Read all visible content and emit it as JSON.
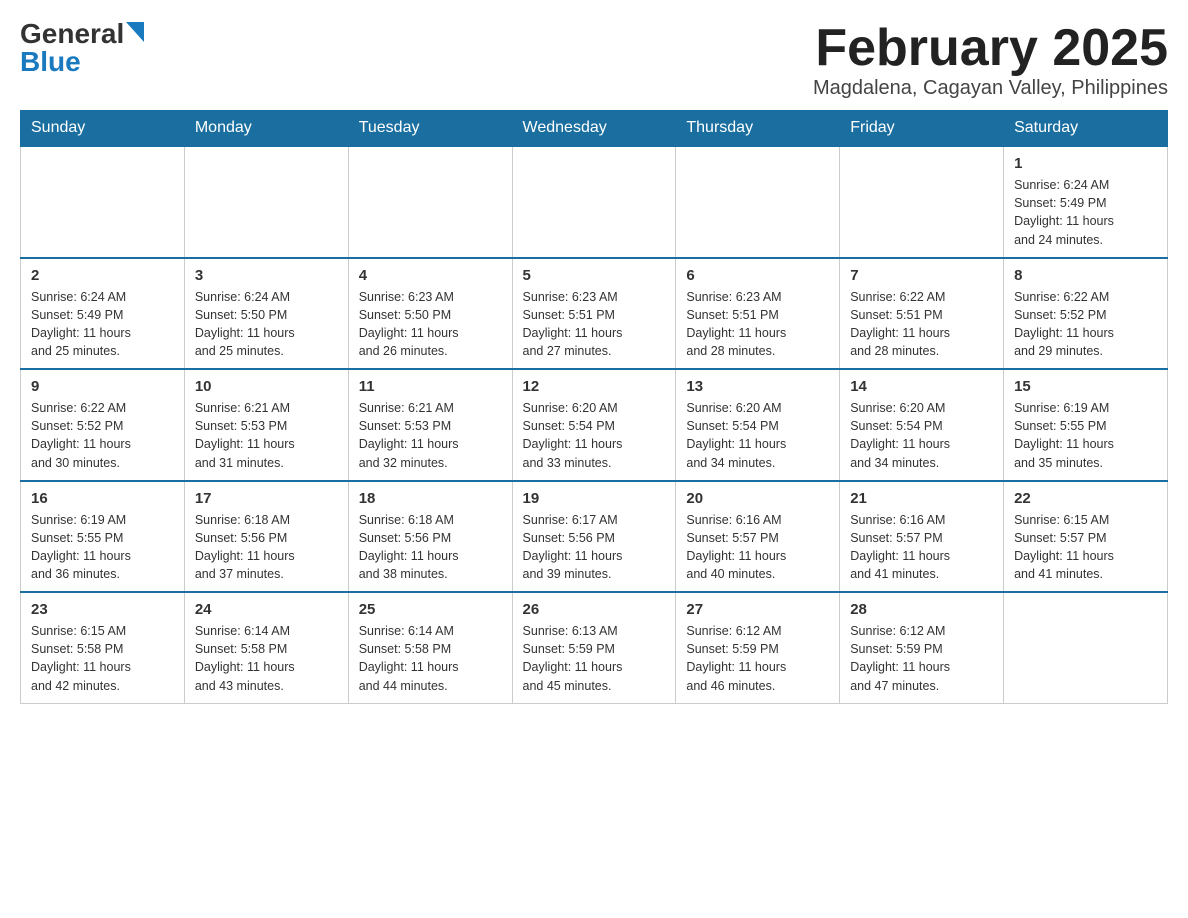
{
  "logo": {
    "general": "General",
    "blue": "Blue"
  },
  "title": "February 2025",
  "subtitle": "Magdalena, Cagayan Valley, Philippines",
  "days_of_week": [
    "Sunday",
    "Monday",
    "Tuesday",
    "Wednesday",
    "Thursday",
    "Friday",
    "Saturday"
  ],
  "weeks": [
    [
      {
        "day": "",
        "info": ""
      },
      {
        "day": "",
        "info": ""
      },
      {
        "day": "",
        "info": ""
      },
      {
        "day": "",
        "info": ""
      },
      {
        "day": "",
        "info": ""
      },
      {
        "day": "",
        "info": ""
      },
      {
        "day": "1",
        "info": "Sunrise: 6:24 AM\nSunset: 5:49 PM\nDaylight: 11 hours\nand 24 minutes."
      }
    ],
    [
      {
        "day": "2",
        "info": "Sunrise: 6:24 AM\nSunset: 5:49 PM\nDaylight: 11 hours\nand 25 minutes."
      },
      {
        "day": "3",
        "info": "Sunrise: 6:24 AM\nSunset: 5:50 PM\nDaylight: 11 hours\nand 25 minutes."
      },
      {
        "day": "4",
        "info": "Sunrise: 6:23 AM\nSunset: 5:50 PM\nDaylight: 11 hours\nand 26 minutes."
      },
      {
        "day": "5",
        "info": "Sunrise: 6:23 AM\nSunset: 5:51 PM\nDaylight: 11 hours\nand 27 minutes."
      },
      {
        "day": "6",
        "info": "Sunrise: 6:23 AM\nSunset: 5:51 PM\nDaylight: 11 hours\nand 28 minutes."
      },
      {
        "day": "7",
        "info": "Sunrise: 6:22 AM\nSunset: 5:51 PM\nDaylight: 11 hours\nand 28 minutes."
      },
      {
        "day": "8",
        "info": "Sunrise: 6:22 AM\nSunset: 5:52 PM\nDaylight: 11 hours\nand 29 minutes."
      }
    ],
    [
      {
        "day": "9",
        "info": "Sunrise: 6:22 AM\nSunset: 5:52 PM\nDaylight: 11 hours\nand 30 minutes."
      },
      {
        "day": "10",
        "info": "Sunrise: 6:21 AM\nSunset: 5:53 PM\nDaylight: 11 hours\nand 31 minutes."
      },
      {
        "day": "11",
        "info": "Sunrise: 6:21 AM\nSunset: 5:53 PM\nDaylight: 11 hours\nand 32 minutes."
      },
      {
        "day": "12",
        "info": "Sunrise: 6:20 AM\nSunset: 5:54 PM\nDaylight: 11 hours\nand 33 minutes."
      },
      {
        "day": "13",
        "info": "Sunrise: 6:20 AM\nSunset: 5:54 PM\nDaylight: 11 hours\nand 34 minutes."
      },
      {
        "day": "14",
        "info": "Sunrise: 6:20 AM\nSunset: 5:54 PM\nDaylight: 11 hours\nand 34 minutes."
      },
      {
        "day": "15",
        "info": "Sunrise: 6:19 AM\nSunset: 5:55 PM\nDaylight: 11 hours\nand 35 minutes."
      }
    ],
    [
      {
        "day": "16",
        "info": "Sunrise: 6:19 AM\nSunset: 5:55 PM\nDaylight: 11 hours\nand 36 minutes."
      },
      {
        "day": "17",
        "info": "Sunrise: 6:18 AM\nSunset: 5:56 PM\nDaylight: 11 hours\nand 37 minutes."
      },
      {
        "day": "18",
        "info": "Sunrise: 6:18 AM\nSunset: 5:56 PM\nDaylight: 11 hours\nand 38 minutes."
      },
      {
        "day": "19",
        "info": "Sunrise: 6:17 AM\nSunset: 5:56 PM\nDaylight: 11 hours\nand 39 minutes."
      },
      {
        "day": "20",
        "info": "Sunrise: 6:16 AM\nSunset: 5:57 PM\nDaylight: 11 hours\nand 40 minutes."
      },
      {
        "day": "21",
        "info": "Sunrise: 6:16 AM\nSunset: 5:57 PM\nDaylight: 11 hours\nand 41 minutes."
      },
      {
        "day": "22",
        "info": "Sunrise: 6:15 AM\nSunset: 5:57 PM\nDaylight: 11 hours\nand 41 minutes."
      }
    ],
    [
      {
        "day": "23",
        "info": "Sunrise: 6:15 AM\nSunset: 5:58 PM\nDaylight: 11 hours\nand 42 minutes."
      },
      {
        "day": "24",
        "info": "Sunrise: 6:14 AM\nSunset: 5:58 PM\nDaylight: 11 hours\nand 43 minutes."
      },
      {
        "day": "25",
        "info": "Sunrise: 6:14 AM\nSunset: 5:58 PM\nDaylight: 11 hours\nand 44 minutes."
      },
      {
        "day": "26",
        "info": "Sunrise: 6:13 AM\nSunset: 5:59 PM\nDaylight: 11 hours\nand 45 minutes."
      },
      {
        "day": "27",
        "info": "Sunrise: 6:12 AM\nSunset: 5:59 PM\nDaylight: 11 hours\nand 46 minutes."
      },
      {
        "day": "28",
        "info": "Sunrise: 6:12 AM\nSunset: 5:59 PM\nDaylight: 11 hours\nand 47 minutes."
      },
      {
        "day": "",
        "info": ""
      }
    ]
  ]
}
